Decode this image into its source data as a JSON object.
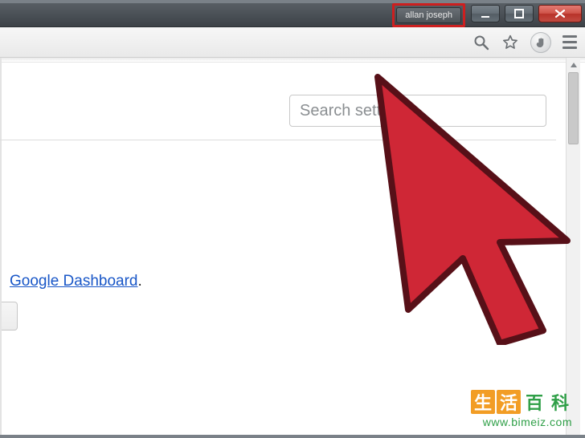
{
  "titlebar": {
    "profile_name": "allan joseph"
  },
  "window_controls": {
    "minimize": "minimize",
    "maximize": "maximize",
    "close": "close"
  },
  "toolbar": {
    "zoom_icon": "zoom-icon",
    "star_icon": "star-icon",
    "hand_icon": "stop-hand-icon",
    "menu_icon": "menu-icon"
  },
  "page": {
    "search_placeholder": "Search settings",
    "dashboard_link_text": "Google Dashboard",
    "dashboard_trailing": "."
  },
  "watermark": {
    "char1": "生",
    "char2": "活",
    "char3": "百",
    "char4": "科",
    "url": "www.bimeiz.com"
  }
}
